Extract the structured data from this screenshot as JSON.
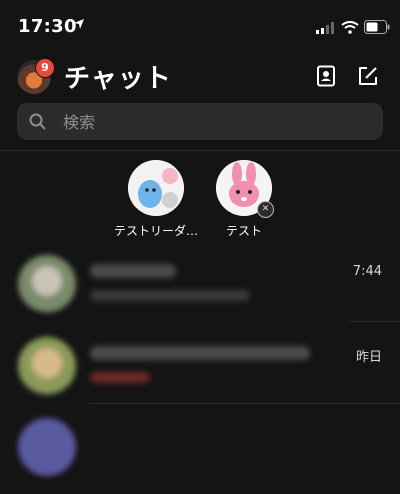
{
  "status_bar": {
    "time": "17:30"
  },
  "header": {
    "title": "チャット",
    "badge_count": "9"
  },
  "search": {
    "placeholder": "検索"
  },
  "selected_members": [
    {
      "name": "テストリーダ…"
    },
    {
      "name": "テスト"
    }
  ],
  "chats": [
    {
      "time": "7:44"
    },
    {
      "time": "昨日"
    }
  ],
  "colors": {
    "background": "#141414",
    "search_bg": "#2c2c2e",
    "badge": "#e8483a"
  }
}
